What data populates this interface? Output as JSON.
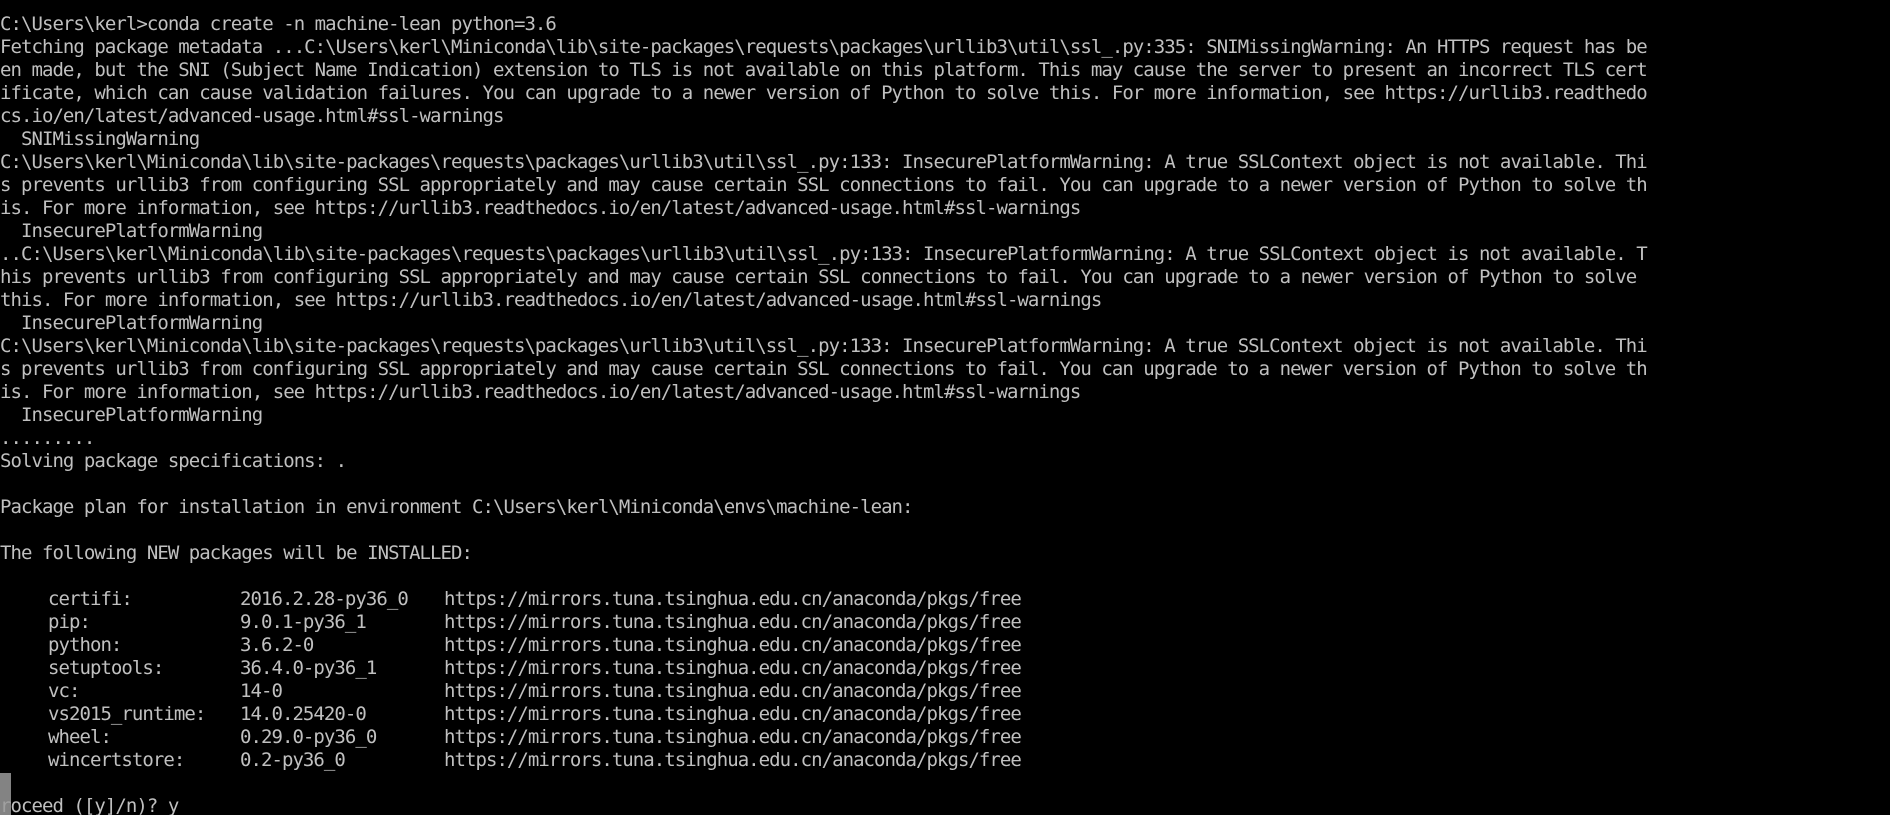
{
  "terminal": {
    "colors": {
      "background": "#000000",
      "foreground": "#c0c0c0",
      "cursor": "#9a9a9a"
    },
    "lines": [
      "C:\\Users\\kerl>conda create -n machine-lean python=3.6",
      "Fetching package metadata ...C:\\Users\\kerl\\Miniconda\\lib\\site-packages\\requests\\packages\\urllib3\\util\\ssl_.py:335: SNIMissingWarning: An HTTPS request has be",
      "en made, but the SNI (Subject Name Indication) extension to TLS is not available on this platform. This may cause the server to present an incorrect TLS cert",
      "ificate, which can cause validation failures. You can upgrade to a newer version of Python to solve this. For more information, see https://urllib3.readthedo",
      "cs.io/en/latest/advanced-usage.html#ssl-warnings",
      "  SNIMissingWarning",
      "C:\\Users\\kerl\\Miniconda\\lib\\site-packages\\requests\\packages\\urllib3\\util\\ssl_.py:133: InsecurePlatformWarning: A true SSLContext object is not available. Thi",
      "s prevents urllib3 from configuring SSL appropriately and may cause certain SSL connections to fail. You can upgrade to a newer version of Python to solve th",
      "is. For more information, see https://urllib3.readthedocs.io/en/latest/advanced-usage.html#ssl-warnings",
      "  InsecurePlatformWarning",
      "..C:\\Users\\kerl\\Miniconda\\lib\\site-packages\\requests\\packages\\urllib3\\util\\ssl_.py:133: InsecurePlatformWarning: A true SSLContext object is not available. T",
      "his prevents urllib3 from configuring SSL appropriately and may cause certain SSL connections to fail. You can upgrade to a newer version of Python to solve",
      "this. For more information, see https://urllib3.readthedocs.io/en/latest/advanced-usage.html#ssl-warnings",
      "  InsecurePlatformWarning",
      "C:\\Users\\kerl\\Miniconda\\lib\\site-packages\\requests\\packages\\urllib3\\util\\ssl_.py:133: InsecurePlatformWarning: A true SSLContext object is not available. Thi",
      "s prevents urllib3 from configuring SSL appropriately and may cause certain SSL connections to fail. You can upgrade to a newer version of Python to solve th",
      "is. For more information, see https://urllib3.readthedocs.io/en/latest/advanced-usage.html#ssl-warnings",
      "  InsecurePlatformWarning",
      ".........",
      "Solving package specifications: .",
      "",
      "Package plan for installation in environment C:\\Users\\kerl\\Miniconda\\envs\\machine-lean:",
      "",
      "The following NEW packages will be INSTALLED:",
      ""
    ],
    "packages": [
      {
        "name": "certifi:",
        "version": "2016.2.28-py36_0",
        "channel": "https://mirrors.tuna.tsinghua.edu.cn/anaconda/pkgs/free"
      },
      {
        "name": "pip:",
        "version": "9.0.1-py36_1",
        "channel": "https://mirrors.tuna.tsinghua.edu.cn/anaconda/pkgs/free"
      },
      {
        "name": "python:",
        "version": "3.6.2-0",
        "channel": "https://mirrors.tuna.tsinghua.edu.cn/anaconda/pkgs/free"
      },
      {
        "name": "setuptools:",
        "version": "36.4.0-py36_1",
        "channel": "https://mirrors.tuna.tsinghua.edu.cn/anaconda/pkgs/free"
      },
      {
        "name": "vc:",
        "version": "14-0",
        "channel": "https://mirrors.tuna.tsinghua.edu.cn/anaconda/pkgs/free"
      },
      {
        "name": "vs2015_runtime:",
        "version": "14.0.25420-0",
        "channel": "https://mirrors.tuna.tsinghua.edu.cn/anaconda/pkgs/free"
      },
      {
        "name": "wheel:",
        "version": "0.29.0-py36_0",
        "channel": "https://mirrors.tuna.tsinghua.edu.cn/anaconda/pkgs/free"
      },
      {
        "name": "wincertstore:",
        "version": "0.2-py36_0",
        "channel": "https://mirrors.tuna.tsinghua.edu.cn/anaconda/pkgs/free"
      }
    ],
    "trailing_lines": [
      "",
      "roceed ([y]/n)? y"
    ]
  }
}
